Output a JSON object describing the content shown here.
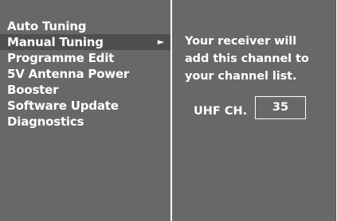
{
  "menu": {
    "items": [
      {
        "label": "Auto Tuning"
      },
      {
        "label": "Manual Tuning",
        "selected": true,
        "submenu_icon": "right-triangle-icon"
      },
      {
        "label": "Programme Edit"
      },
      {
        "label": "5V Antenna Power"
      },
      {
        "label": "Booster"
      },
      {
        "label": "Software Update"
      },
      {
        "label": "Diagnostics"
      }
    ],
    "arrow_glyph": "►"
  },
  "panel": {
    "message_lines": [
      "Your receiver will",
      "add this channel to",
      "your channel list."
    ],
    "channel_label": "UHF CH.",
    "channel_value": "35"
  },
  "colors": {
    "background": "#686868",
    "selected_row": "#4f4f4f",
    "text": "#ffffff"
  }
}
